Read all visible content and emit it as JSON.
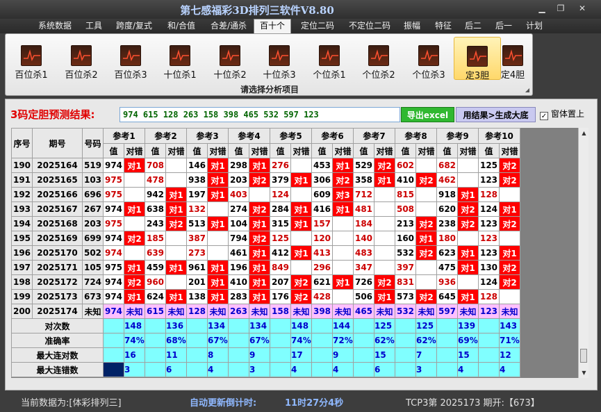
{
  "window": {
    "title": "第七感福彩3D排列三软件V8.80"
  },
  "menu": [
    "系统数据",
    "工具",
    "跨度/复式",
    "和/合值",
    "合差/通杀",
    "百十个",
    "定位二码",
    "不定位二码",
    "振幅",
    "特征",
    "后二",
    "后一",
    "计划"
  ],
  "menu_active": "百十个",
  "ribbon": {
    "buttons": [
      "百位杀1",
      "百位杀2",
      "百位杀3",
      "十位杀1",
      "十位杀2",
      "十位杀3",
      "个位杀1",
      "个位杀2",
      "个位杀3",
      "定3胆",
      "定4胆"
    ],
    "active": "定3胆",
    "caption": "请选择分析项目"
  },
  "result": {
    "label": "3码定胆预测结果:",
    "value": "974 615 128 263 158 398 465 532 597 123",
    "excel_button": "导出excel",
    "generate_button": "用结果>生成大底",
    "topmost_label": "窗体置上",
    "topmost_checked": true
  },
  "table": {
    "headers": {
      "seq": "序号",
      "issue": "期号",
      "code": "号码",
      "val": "值",
      "mark": "对错"
    },
    "refs": [
      "参考1",
      "参考2",
      "参考3",
      "参考4",
      "参考5",
      "参考6",
      "参考7",
      "参考8",
      "参考9",
      "参考10"
    ],
    "rows": [
      {
        "seq": "190",
        "issue": "2025164",
        "code": "519",
        "cells": [
          [
            "974",
            "对1"
          ],
          [
            "708",
            ""
          ],
          [
            "146",
            "对1"
          ],
          [
            "298",
            "对1"
          ],
          [
            "276",
            ""
          ],
          [
            "453",
            "对1"
          ],
          [
            "529",
            "对2"
          ],
          [
            "602",
            ""
          ],
          [
            "682",
            ""
          ],
          [
            "125",
            "对2"
          ]
        ]
      },
      {
        "seq": "191",
        "issue": "2025165",
        "code": "103",
        "cells": [
          [
            "975",
            ""
          ],
          [
            "478",
            ""
          ],
          [
            "938",
            "对1"
          ],
          [
            "203",
            "对2"
          ],
          [
            "379",
            "对1"
          ],
          [
            "306",
            "对2"
          ],
          [
            "358",
            "对1"
          ],
          [
            "410",
            "对2"
          ],
          [
            "462",
            ""
          ],
          [
            "123",
            "对2"
          ]
        ]
      },
      {
        "seq": "192",
        "issue": "2025166",
        "code": "696",
        "cells": [
          [
            "975",
            ""
          ],
          [
            "942",
            "对1"
          ],
          [
            "197",
            "对1"
          ],
          [
            "403",
            ""
          ],
          [
            "124",
            ""
          ],
          [
            "609",
            "对3"
          ],
          [
            "712",
            ""
          ],
          [
            "815",
            ""
          ],
          [
            "918",
            "对1"
          ],
          [
            "128",
            ""
          ]
        ]
      },
      {
        "seq": "193",
        "issue": "2025167",
        "code": "267",
        "cells": [
          [
            "974",
            "对1"
          ],
          [
            "638",
            "对1"
          ],
          [
            "132",
            ""
          ],
          [
            "274",
            "对2"
          ],
          [
            "284",
            "对1"
          ],
          [
            "416",
            "对1"
          ],
          [
            "481",
            ""
          ],
          [
            "508",
            ""
          ],
          [
            "620",
            "对2"
          ],
          [
            "124",
            "对1"
          ]
        ]
      },
      {
        "seq": "194",
        "issue": "2025168",
        "code": "203",
        "cells": [
          [
            "975",
            ""
          ],
          [
            "243",
            "对2"
          ],
          [
            "513",
            "对1"
          ],
          [
            "104",
            "对1"
          ],
          [
            "315",
            "对1"
          ],
          [
            "157",
            ""
          ],
          [
            "184",
            ""
          ],
          [
            "213",
            "对2"
          ],
          [
            "238",
            "对2"
          ],
          [
            "123",
            "对2"
          ]
        ]
      },
      {
        "seq": "195",
        "issue": "2025169",
        "code": "699",
        "cells": [
          [
            "974",
            "对2"
          ],
          [
            "185",
            ""
          ],
          [
            "387",
            ""
          ],
          [
            "794",
            "对2"
          ],
          [
            "125",
            ""
          ],
          [
            "120",
            ""
          ],
          [
            "140",
            ""
          ],
          [
            "160",
            "对1"
          ],
          [
            "180",
            ""
          ],
          [
            "123",
            ""
          ]
        ]
      },
      {
        "seq": "196",
        "issue": "2025170",
        "code": "502",
        "cells": [
          [
            "974",
            ""
          ],
          [
            "639",
            ""
          ],
          [
            "273",
            ""
          ],
          [
            "461",
            "对1"
          ],
          [
            "412",
            "对1"
          ],
          [
            "413",
            ""
          ],
          [
            "483",
            ""
          ],
          [
            "532",
            "对2"
          ],
          [
            "623",
            "对1"
          ],
          [
            "123",
            "对1"
          ]
        ]
      },
      {
        "seq": "197",
        "issue": "2025171",
        "code": "105",
        "cells": [
          [
            "975",
            "对1"
          ],
          [
            "459",
            "对1"
          ],
          [
            "961",
            "对1"
          ],
          [
            "196",
            "对1"
          ],
          [
            "849",
            ""
          ],
          [
            "296",
            ""
          ],
          [
            "347",
            ""
          ],
          [
            "397",
            ""
          ],
          [
            "475",
            "对1"
          ],
          [
            "130",
            "对2"
          ]
        ]
      },
      {
        "seq": "198",
        "issue": "2025172",
        "code": "724",
        "cells": [
          [
            "974",
            "对2"
          ],
          [
            "960",
            ""
          ],
          [
            "201",
            "对1"
          ],
          [
            "410",
            "对1"
          ],
          [
            "207",
            "对2"
          ],
          [
            "621",
            "对1"
          ],
          [
            "726",
            "对2"
          ],
          [
            "831",
            ""
          ],
          [
            "936",
            ""
          ],
          [
            "124",
            "对2"
          ]
        ]
      },
      {
        "seq": "199",
        "issue": "2025173",
        "code": "673",
        "cells": [
          [
            "974",
            "对1"
          ],
          [
            "624",
            "对1"
          ],
          [
            "138",
            "对1"
          ],
          [
            "283",
            "对1"
          ],
          [
            "176",
            "对2"
          ],
          [
            "428",
            ""
          ],
          [
            "506",
            "对1"
          ],
          [
            "573",
            "对2"
          ],
          [
            "645",
            "对1"
          ],
          [
            "128",
            ""
          ]
        ]
      }
    ],
    "future": {
      "seq": "200",
      "issue": "2025174",
      "code": "未知",
      "cells": [
        "974",
        "615",
        "128",
        "263",
        "158",
        "398",
        "465",
        "532",
        "597",
        "123"
      ],
      "mark": "未知"
    },
    "stats": [
      {
        "label": "对次数",
        "values": [
          "148",
          "136",
          "134",
          "134",
          "148",
          "144",
          "125",
          "125",
          "139",
          "143"
        ]
      },
      {
        "label": "准确率",
        "values": [
          "74%",
          "68%",
          "67%",
          "67%",
          "74%",
          "72%",
          "62%",
          "62%",
          "69%",
          "71%"
        ]
      },
      {
        "label": "最大连对数",
        "values": [
          "16",
          "11",
          "8",
          "9",
          "17",
          "9",
          "15",
          "7",
          "15",
          "12"
        ]
      },
      {
        "label": "最大连错数",
        "values": [
          "3",
          "6",
          "4",
          "3",
          "4",
          "4",
          "6",
          "3",
          "4",
          "4"
        ]
      }
    ]
  },
  "status": {
    "current_data": "当前数据为:[体彩排列三]",
    "countdown_label": "自动更新倒计时:",
    "countdown_value": "11时27分4秒",
    "latest": "TCP3第 2025173 期开:【673】"
  },
  "colors": {
    "hit": "#ff0000",
    "future_row": "#ffc0ff",
    "stat_row": "#80ffff",
    "title_text": "#b9d3ff"
  }
}
